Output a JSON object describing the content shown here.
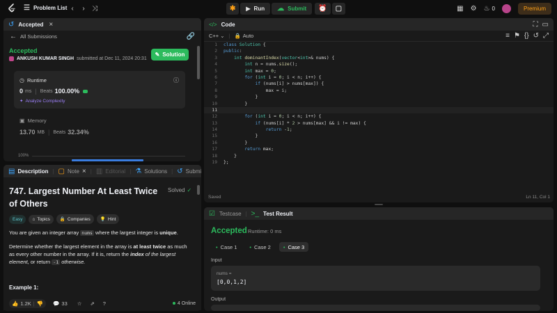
{
  "nav": {
    "problem_list": "Problem List",
    "run": "Run",
    "submit": "Submit",
    "fire_count": "0",
    "premium": "Premium"
  },
  "submission": {
    "tab": "Accepted",
    "back": "All Submissions",
    "status": "Accepted",
    "user": "ANKUSH KUMAR SINGH",
    "submitted_at": "submitted at Dec 11, 2024 20:31",
    "solution_btn": "Solution",
    "runtime_label": "Runtime",
    "runtime_value": "0",
    "runtime_unit": "ms",
    "beats_label": "Beats",
    "runtime_beats": "100.00%",
    "analyze": "Analyze Complexity",
    "memory_label": "Memory",
    "memory_value": "13.70",
    "memory_unit": "MB",
    "memory_beats": "32.34%",
    "hist_label": "100%"
  },
  "description_tabs": {
    "description": "Description",
    "note": "Note",
    "editorial": "Editorial",
    "solutions": "Solutions",
    "submissions": "Submissions"
  },
  "problem": {
    "title": "747. Largest Number At Least Twice of Others",
    "solved": "Solved",
    "difficulty": "Easy",
    "topics": "Topics",
    "companies": "Companies",
    "hint": "Hint",
    "p1_a": "You are given an integer array ",
    "p1_code": "nums",
    "p1_b": " where the largest integer is ",
    "p1_bold": "unique",
    "p1_c": ".",
    "p2_a": "Determine whether the largest element in the array is ",
    "p2_bold": "at least twice",
    "p2_b": " as much as every other number in the array. If it is, return the ",
    "p2_italic_bold": "index",
    "p2_italic": " of the largest element,",
    "p2_c": " or return ",
    "p2_code": "-1",
    "p2_italic2": " otherwise.",
    "example": "Example 1:"
  },
  "footer": {
    "likes": "1.2K",
    "comments": "33",
    "online": "4 Online"
  },
  "code": {
    "header": "Code",
    "lang": "C++",
    "mode": "Auto",
    "saved": "Saved",
    "cursor": "Ln 11, Col 1",
    "lines": [
      "class Solution {",
      "public:",
      "    int dominantIndex(vector<int>& nums) {",
      "        int n = nums.size();",
      "        int max = 0;",
      "        for (int i = 0; i < n; i++) {",
      "            if (nums[i] > nums[max]) {",
      "                max = i;",
      "            }",
      "        }",
      "",
      "        for (int i = 0; i < n; i++) {",
      "            if (nums[i] * 2 > nums[max] && i != max) {",
      "                return -1;",
      "            }",
      "        }",
      "        return max;",
      "    }",
      "};"
    ]
  },
  "test": {
    "tab_testcase": "Testcase",
    "tab_result": "Test Result",
    "status": "Accepted",
    "runtime": "Runtime: 0 ms",
    "cases": [
      "Case 1",
      "Case 2",
      "Case 3"
    ],
    "input_label": "Input",
    "param": "nums =",
    "value": "[0,0,1,2]",
    "output_label": "Output"
  },
  "colors": {
    "accent_green": "#2cbb5d",
    "brand_orange": "#ffa116",
    "panel": "#1a1a1a"
  }
}
